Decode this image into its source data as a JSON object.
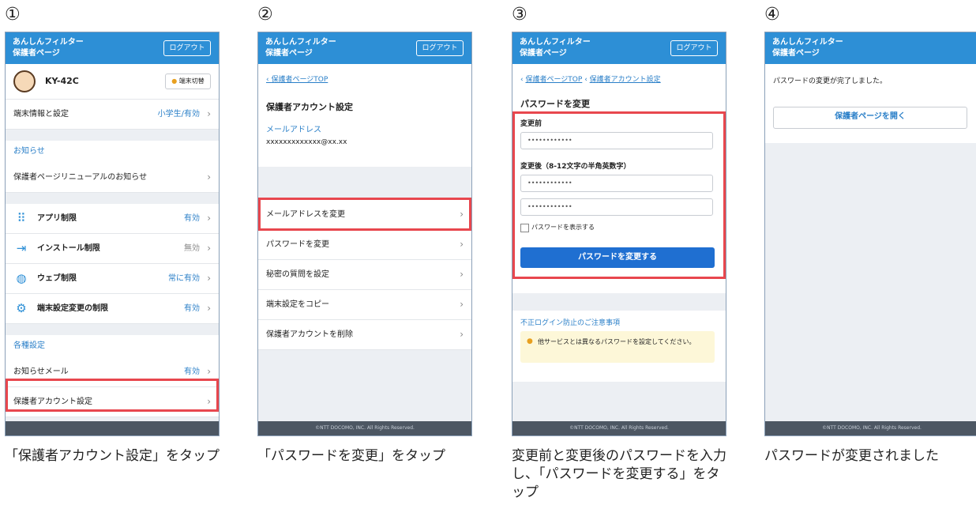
{
  "colors": {
    "header": "#2d8fd6",
    "highlight": "#e8474e",
    "link": "#2a7fc8",
    "primary_button": "#1f6fd1",
    "footer": "#4d5763"
  },
  "common": {
    "app_title_1": "あんしんフィルター",
    "app_title_2": "保護者ページ",
    "logout": "ログアウト",
    "footer": "©NTT DOCOMO, INC. All Rights Reserved."
  },
  "steps": [
    {
      "number": "①",
      "caption": "「保護者アカウント設定」をタップ",
      "device_name": "KY-42C",
      "device_badge": "端末切替",
      "device_info": {
        "label": "端末情報と設定",
        "value": "小学生/有効"
      },
      "notice_section": "お知らせ",
      "notice_item": "保護者ページリニューアルのお知らせ",
      "restrictions": [
        {
          "label": "アプリ制限",
          "value": "有効",
          "icon": "apps-icon"
        },
        {
          "label": "インストール制限",
          "value": "無効",
          "icon": "install-icon"
        },
        {
          "label": "ウェブ制限",
          "value": "常に有効",
          "icon": "globe-icon"
        },
        {
          "label": "端末設定変更の制限",
          "value": "有効",
          "icon": "device-settings-icon"
        }
      ],
      "settings_section": "各種設定",
      "mail_item": {
        "label": "お知らせメール",
        "value": "有効"
      },
      "account_item": "保護者アカウント設定"
    },
    {
      "number": "②",
      "caption": "「パスワードを変更」をタップ",
      "breadcrumb": "保護者ページTOP",
      "page_title": "保護者アカウント設定",
      "email_label": "メールアドレス",
      "email_value": "xxxxxxxxxxxxx@xx.xx",
      "menu": [
        "メールアドレスを変更",
        "パスワードを変更",
        "秘密の質問を設定",
        "端末設定をコピー",
        "保護者アカウントを削除"
      ]
    },
    {
      "number": "③",
      "caption": "変更前と変更後のパスワードを入力し、「パスワードを変更する」をタップ",
      "breadcrumb_1": "保護者ページTOP",
      "breadcrumb_2": "保護者アカウント設定",
      "page_title": "パスワードを変更",
      "before_label": "変更前",
      "before_value": "••••••••••••",
      "after_label": "変更後（8-12文字の半角英数字）",
      "after_value": "••••••••••••",
      "confirm_value": "••••••••••••",
      "show_password": "パスワードを表示する",
      "submit": "パスワードを変更する",
      "warning_title": "不正ログイン防止のご注意事項",
      "warning_text": "他サービスとは異なるパスワードを設定してください。"
    },
    {
      "number": "④",
      "caption": "パスワードが変更されました",
      "message": "パスワードの変更が完了しました。",
      "open_button": "保護者ページを開く"
    }
  ]
}
